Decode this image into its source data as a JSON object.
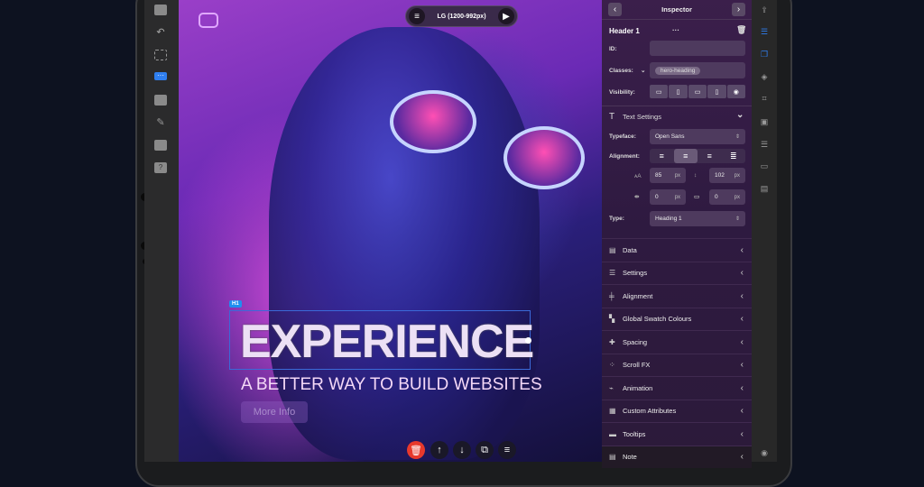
{
  "device_bar": {
    "label": "LG (1200-992px)"
  },
  "canvas": {
    "selection_tag": "H1",
    "heading": "EXPERIENCE",
    "subheading": "A BETTER WAY TO BUILD WEBSITES",
    "button": "More Info"
  },
  "inspector": {
    "title": "Inspector",
    "element_name": "Header 1",
    "more": "···",
    "id_label": "ID:",
    "id_value": "",
    "classes_label": "Classes:",
    "class_chip": "hero-heading",
    "visibility_label": "Visibility:",
    "text_settings": "Text Settings",
    "typeface_label": "Typeface:",
    "typeface": "Open Sans",
    "alignment_label": "Alignment:",
    "font_size": "85",
    "line_height": "102",
    "letter_spacing": "0",
    "word_spacing": "0",
    "unit": "px",
    "type_label": "Type:",
    "type": "Heading 1",
    "sections": [
      "Data",
      "Settings",
      "Alignment",
      "Global Swatch Colours",
      "Spacing",
      "Scroll FX",
      "Animation",
      "Custom Attributes",
      "Tooltips",
      "Note"
    ]
  },
  "colors": {
    "accent": "#1f8ef0",
    "delete": "#e8392c",
    "inspector_bg": "#3b1f4b"
  }
}
